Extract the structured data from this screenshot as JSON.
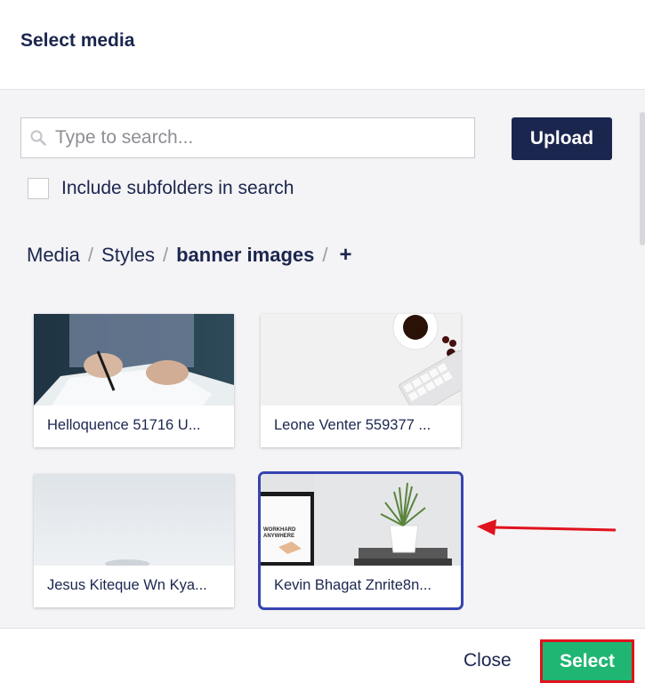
{
  "dialog": {
    "title": "Select media"
  },
  "search": {
    "placeholder": "Type to search...",
    "value": "",
    "upload_label": "Upload"
  },
  "subfolders": {
    "label": "Include subfolders in search",
    "checked": false
  },
  "breadcrumb": {
    "items": [
      "Media",
      "Styles"
    ],
    "current": "banner images",
    "add": "+"
  },
  "media_items": [
    {
      "label": "Helloquence 51716 U...",
      "selected": false
    },
    {
      "label": "Leone Venter 559377 ...",
      "selected": false
    },
    {
      "label": "Jesus Kiteque Wn Kya...",
      "selected": false
    },
    {
      "label": "Kevin Bhagat Znrite8n...",
      "selected": true,
      "image_text": [
        "WORKHARD",
        "ANYWHERE"
      ]
    }
  ],
  "footer": {
    "close_label": "Close",
    "select_label": "Select"
  },
  "colors": {
    "primary": "#1b264f",
    "success": "#1fb572",
    "highlight_border": "#e0121d",
    "selection": "#3544b1",
    "arrow": "#e0121d"
  },
  "icons": {
    "search": "search-icon",
    "arrow": "pointer-arrow-icon",
    "add": "plus-icon"
  }
}
